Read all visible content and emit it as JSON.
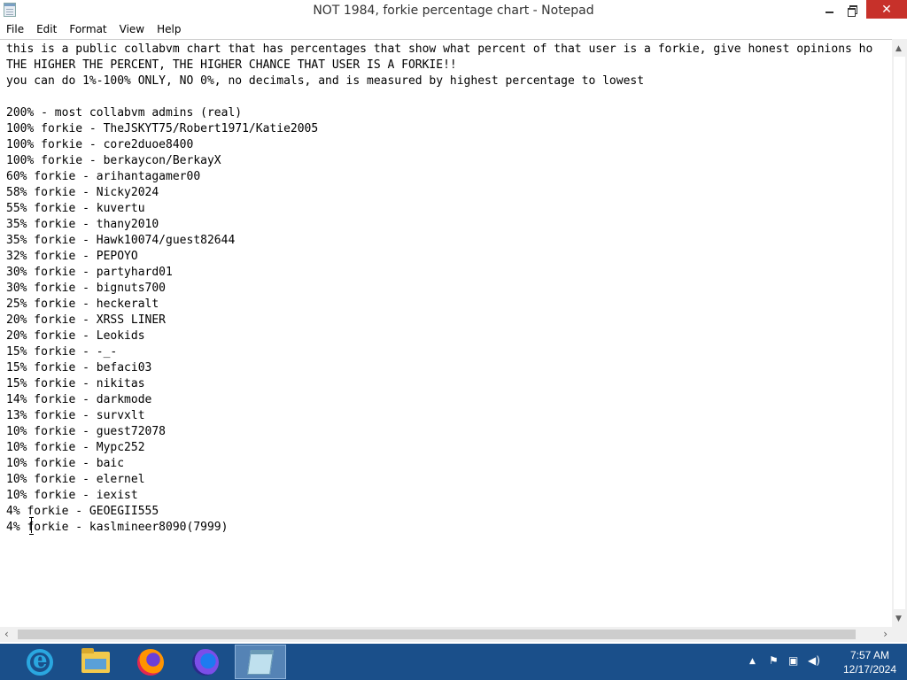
{
  "window": {
    "title": "NOT 1984, forkie percentage chart - Notepad",
    "minimize_label": "–",
    "close_label": "✕"
  },
  "menubar": {
    "items": [
      "File",
      "Edit",
      "Format",
      "View",
      "Help"
    ]
  },
  "editor": {
    "lines": [
      "this is a public collabvm chart that has percentages that show what percent of that user is a forkie, give honest opinions ho",
      "THE HIGHER THE PERCENT, THE HIGHER CHANCE THAT USER IS A FORKIE!!",
      "you can do 1%-100% ONLY, NO 0%, no decimals, and is measured by highest percentage to lowest",
      "",
      "200% - most collabvm admins (real)",
      "100% forkie - TheJSKYT75/Robert1971/Katie2005",
      "100% forkie - core2duoe8400",
      "100% forkie - berkaycon/BerkayX",
      "60% forkie - arihantagamer00",
      "58% forkie - Nicky2024",
      "55% forkie - kuvertu",
      "35% forkie - thany2010",
      "35% forkie - Hawk10074/guest82644",
      "32% forkie - PEPOYO",
      "30% forkie - partyhard01",
      "30% forkie - bignuts700",
      "25% forkie - heckeralt",
      "20% forkie - XRSS LINER",
      "20% forkie - Leokids",
      "15% forkie - -_-",
      "15% forkie - befaci03",
      "15% forkie - nikitas",
      "14% forkie - darkmode",
      "13% forkie - survxlt",
      "10% forkie - guest72078",
      "10% forkie - Mypc252",
      "10% forkie - baic",
      "10% forkie - elernel",
      "10% forkie - iexist",
      "4% forkie - GEOEGII555",
      "4% forkie - kaslmineer8090(7999)"
    ]
  },
  "taskbar": {
    "apps": [
      {
        "name": "internet-explorer-icon"
      },
      {
        "name": "file-explorer-icon"
      },
      {
        "name": "firefox-icon"
      },
      {
        "name": "firefox-developer-icon"
      },
      {
        "name": "notepad-icon"
      }
    ],
    "tray": {
      "time": "7:57 AM",
      "date": "12/17/2024"
    }
  }
}
